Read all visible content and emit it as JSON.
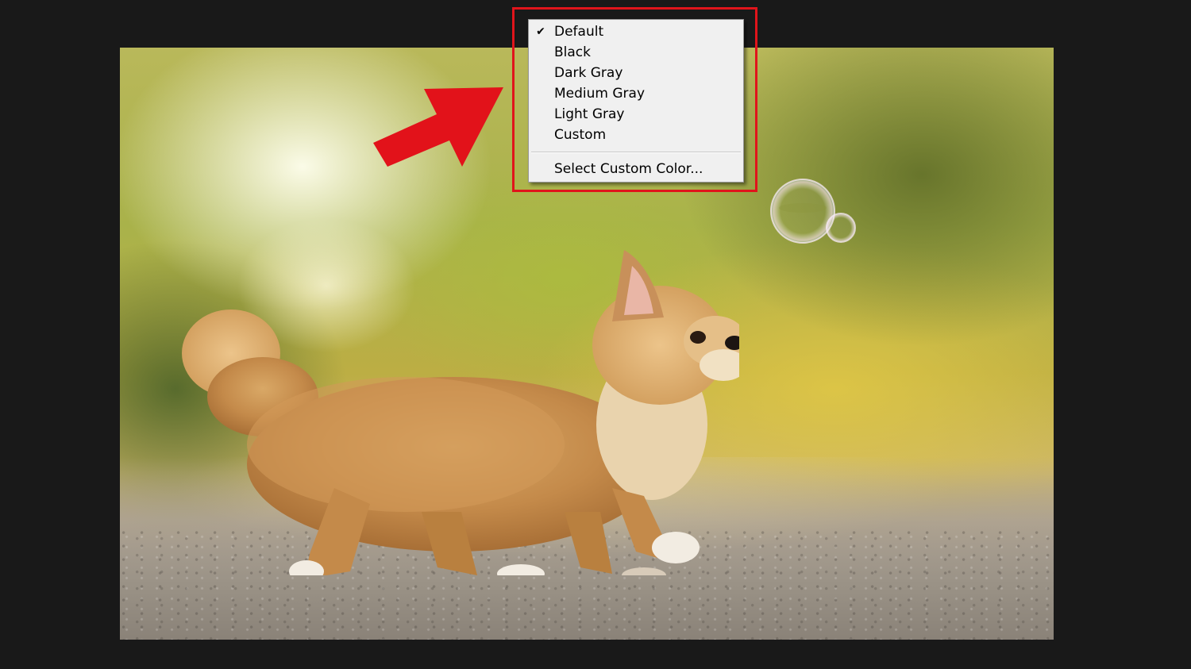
{
  "menu": {
    "items": [
      {
        "label": "Default",
        "checked": true
      },
      {
        "label": "Black",
        "checked": false
      },
      {
        "label": "Dark Gray",
        "checked": false
      },
      {
        "label": "Medium Gray",
        "checked": false
      },
      {
        "label": "Light Gray",
        "checked": false
      },
      {
        "label": "Custom",
        "checked": false
      }
    ],
    "custom_color_label": "Select Custom Color...",
    "check_glyph": "✔"
  },
  "colors": {
    "highlight": "#e0141b",
    "arrow": "#e2121a",
    "canvas_background": "#191919",
    "menu_background": "#f0f0f0"
  },
  "icons": {
    "arrow": "arrow-pointer-icon",
    "check": "check-icon"
  }
}
